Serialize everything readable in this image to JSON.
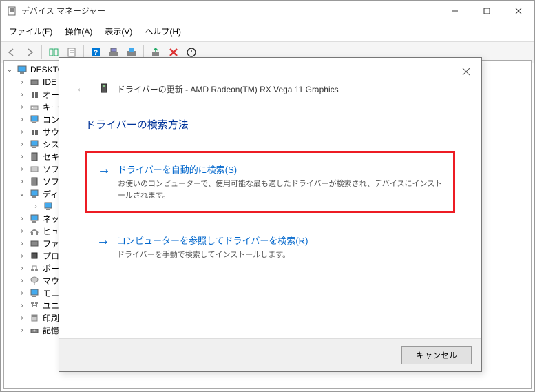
{
  "window": {
    "title": "デバイス マネージャー"
  },
  "menubar": {
    "file": "ファイル(F)",
    "action": "操作(A)",
    "view": "表示(V)",
    "help": "ヘルプ(H)"
  },
  "tree": {
    "root": "DESKTO",
    "items": [
      {
        "label": "IDE"
      },
      {
        "label": "オー"
      },
      {
        "label": "キー"
      },
      {
        "label": "コン"
      },
      {
        "label": "サウ"
      },
      {
        "label": "シス"
      },
      {
        "label": "セキ"
      },
      {
        "label": "ソフ"
      },
      {
        "label": "ソフ"
      },
      {
        "label": "ディ",
        "expanded": true
      },
      {
        "label": ""
      },
      {
        "label": "ネッ"
      },
      {
        "label": "ヒュ"
      },
      {
        "label": "ファ"
      },
      {
        "label": "プロ"
      },
      {
        "label": "ポー"
      },
      {
        "label": "マウ"
      },
      {
        "label": "モニ"
      },
      {
        "label": "ユニ"
      },
      {
        "label": "印刷"
      },
      {
        "label": "記憶"
      }
    ]
  },
  "dialog": {
    "title": "ドライバーの更新 - AMD Radeon(TM) RX Vega 11 Graphics",
    "heading": "ドライバーの検索方法",
    "option1": {
      "title": "ドライバーを自動的に検索(S)",
      "desc": "お使いのコンピューターで、使用可能な最も適したドライバーが検索され、デバイスにインストールされます。"
    },
    "option2": {
      "title": "コンピューターを参照してドライバーを検索(R)",
      "desc": "ドライバーを手動で検索してインストールします。"
    },
    "cancel": "キャンセル"
  }
}
